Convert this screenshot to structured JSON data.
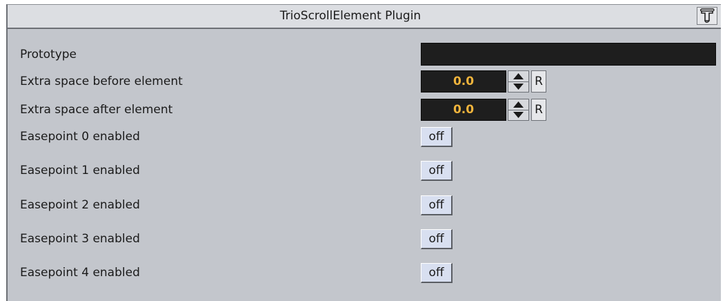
{
  "header": {
    "title": "TrioScrollElement Plugin",
    "icon": "script-scroll-icon"
  },
  "rows": {
    "prototype": {
      "label": "Prototype",
      "value": ""
    },
    "extra_before": {
      "label": "Extra space before element",
      "value": "0.0",
      "reset_label": "R"
    },
    "extra_after": {
      "label": "Extra space after element",
      "value": "0.0",
      "reset_label": "R"
    },
    "easepoints": [
      {
        "label": "Easepoint 0 enabled",
        "state": "off"
      },
      {
        "label": "Easepoint 1 enabled",
        "state": "off"
      },
      {
        "label": "Easepoint 2 enabled",
        "state": "off"
      },
      {
        "label": "Easepoint 3 enabled",
        "state": "off"
      },
      {
        "label": "Easepoint 4 enabled",
        "state": "off"
      }
    ]
  },
  "colors": {
    "panel_bg": "#c3c6cc",
    "field_bg": "#1e1e1e",
    "value_text": "#f0b43c",
    "toggle_bg": "#d8dff0"
  }
}
